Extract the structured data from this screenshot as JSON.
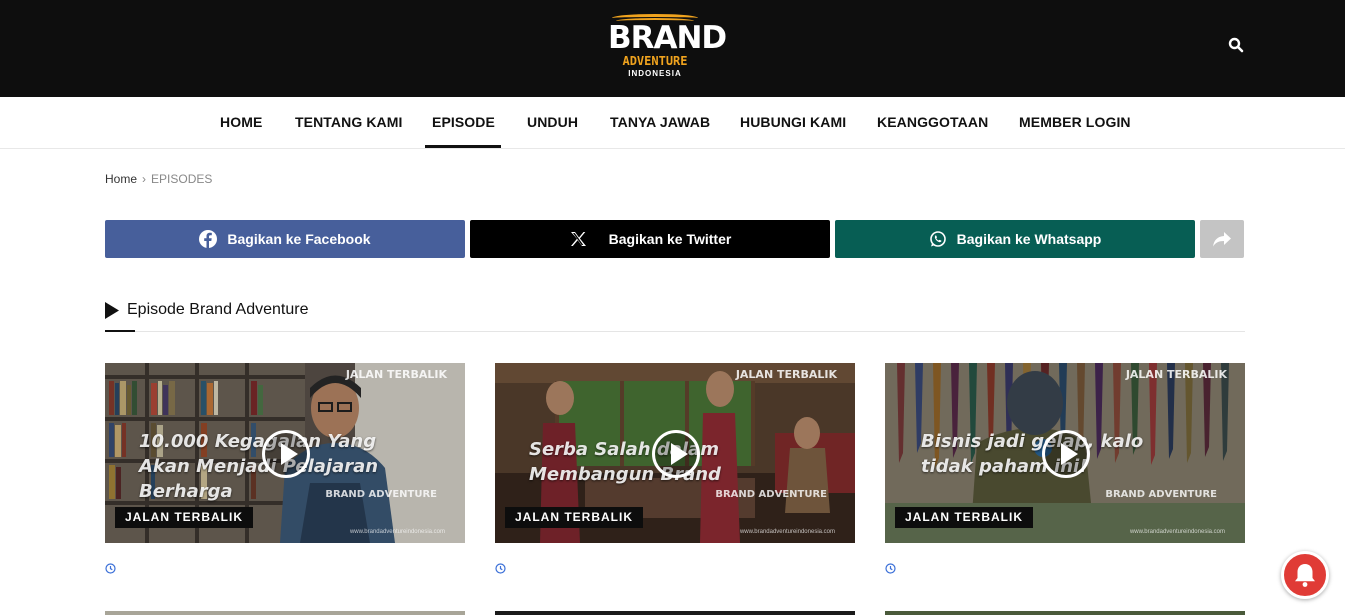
{
  "header": {
    "logo": {
      "line1": "BRAND",
      "line2": "ADVENTURE",
      "line3": "INDONESIA"
    },
    "search_icon": "search-icon"
  },
  "nav": {
    "items": [
      {
        "label": "HOME"
      },
      {
        "label": "TENTANG KAMI"
      },
      {
        "label": "EPISODE",
        "active": true
      },
      {
        "label": "UNDUH"
      },
      {
        "label": "TANYA JAWAB"
      },
      {
        "label": "HUBUNGI KAMI"
      },
      {
        "label": "KEANGGOTAAN"
      },
      {
        "label": "MEMBER LOGIN"
      }
    ]
  },
  "breadcrumb": {
    "home": "Home",
    "separator": "›",
    "current": "EPISODES"
  },
  "share": {
    "facebook": {
      "label": "Bagikan ke Facebook",
      "icon": "facebook-icon",
      "color": "#475f9b"
    },
    "twitter": {
      "label": "Bagikan ke Twitter",
      "icon": "x-icon",
      "color": "#000000"
    },
    "whatsapp": {
      "label": "Bagikan ke Whatsapp",
      "icon": "whatsapp-icon",
      "color": "#075e54"
    },
    "more": {
      "icon": "share-icon",
      "color": "#c4c4c4"
    }
  },
  "section": {
    "title": "Episode Brand Adventure",
    "icon": "play-triangle-icon"
  },
  "cards": [
    {
      "title": "10.000 Kegagalan Yang Akan Menjadi Pelajaran Berharga",
      "show_logo": "JALAN TERBALIK",
      "category": "JALAN TERBALIK",
      "watermark": "www.brandadventureindonesia.com",
      "corner_logo": "BRAND ADVENTURE"
    },
    {
      "title": "Serba Salah dalam Membangun Brand",
      "show_logo": "JALAN TERBALIK",
      "category": "JALAN TERBALIK",
      "watermark": "www.brandadventureindonesia.com",
      "corner_logo": "BRAND ADVENTURE"
    },
    {
      "title": "Bisnis jadi gelap, kalo tidak paham ini!",
      "show_logo": "JALAN TERBALIK",
      "category": "JALAN TERBALIK",
      "watermark": "www.brandadventureindonesia.com",
      "corner_logo": "BRAND ADVENTURE"
    }
  ],
  "colors": {
    "accent": "#f0a31e",
    "notification": "#e03b36",
    "meta_icon": "#3a6fd8"
  }
}
